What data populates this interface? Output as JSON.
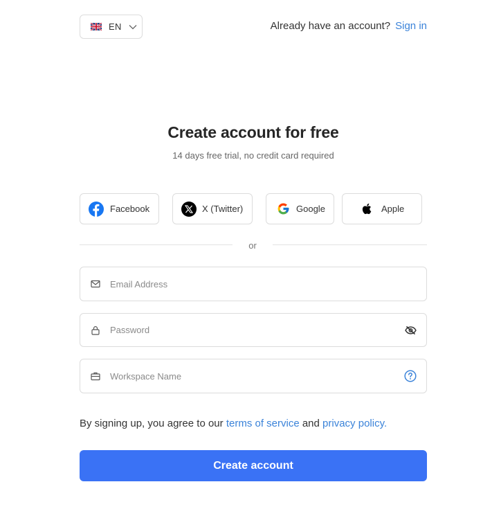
{
  "header": {
    "language": {
      "code": "EN",
      "flag_icon": "uk-flag-icon",
      "chevron_icon": "chevron-down-icon"
    },
    "already_have_account": "Already have an account?",
    "sign_in": "Sign in"
  },
  "main": {
    "title": "Create account for free",
    "subtitle": "14 days free trial, no credit card required"
  },
  "social": [
    {
      "label": "Facebook",
      "icon": "facebook-icon"
    },
    {
      "label": "X (Twitter)",
      "icon": "x-twitter-icon"
    },
    {
      "label": "Google",
      "icon": "google-icon"
    },
    {
      "label": "Apple",
      "icon": "apple-icon"
    }
  ],
  "divider_text": "or",
  "form": {
    "email": {
      "placeholder": "Email Address",
      "value": "",
      "icon": "mail-icon"
    },
    "password": {
      "placeholder": "Password",
      "value": "",
      "icon": "lock-icon",
      "toggle_icon": "eye-off-icon"
    },
    "workspace": {
      "placeholder": "Workspace Name",
      "value": "",
      "icon": "briefcase-icon",
      "help_icon": "question-circle-icon"
    }
  },
  "terms": {
    "prefix": "By signing up, you agree to our",
    "tos": "terms of service",
    "and": "and",
    "privacy": "privacy policy."
  },
  "submit_label": "Create account",
  "colors": {
    "accent": "#3a72f5",
    "link": "#3b83d9",
    "border": "#dcdcdc",
    "facebook": "#1877f2",
    "help": "#3b83d9"
  }
}
